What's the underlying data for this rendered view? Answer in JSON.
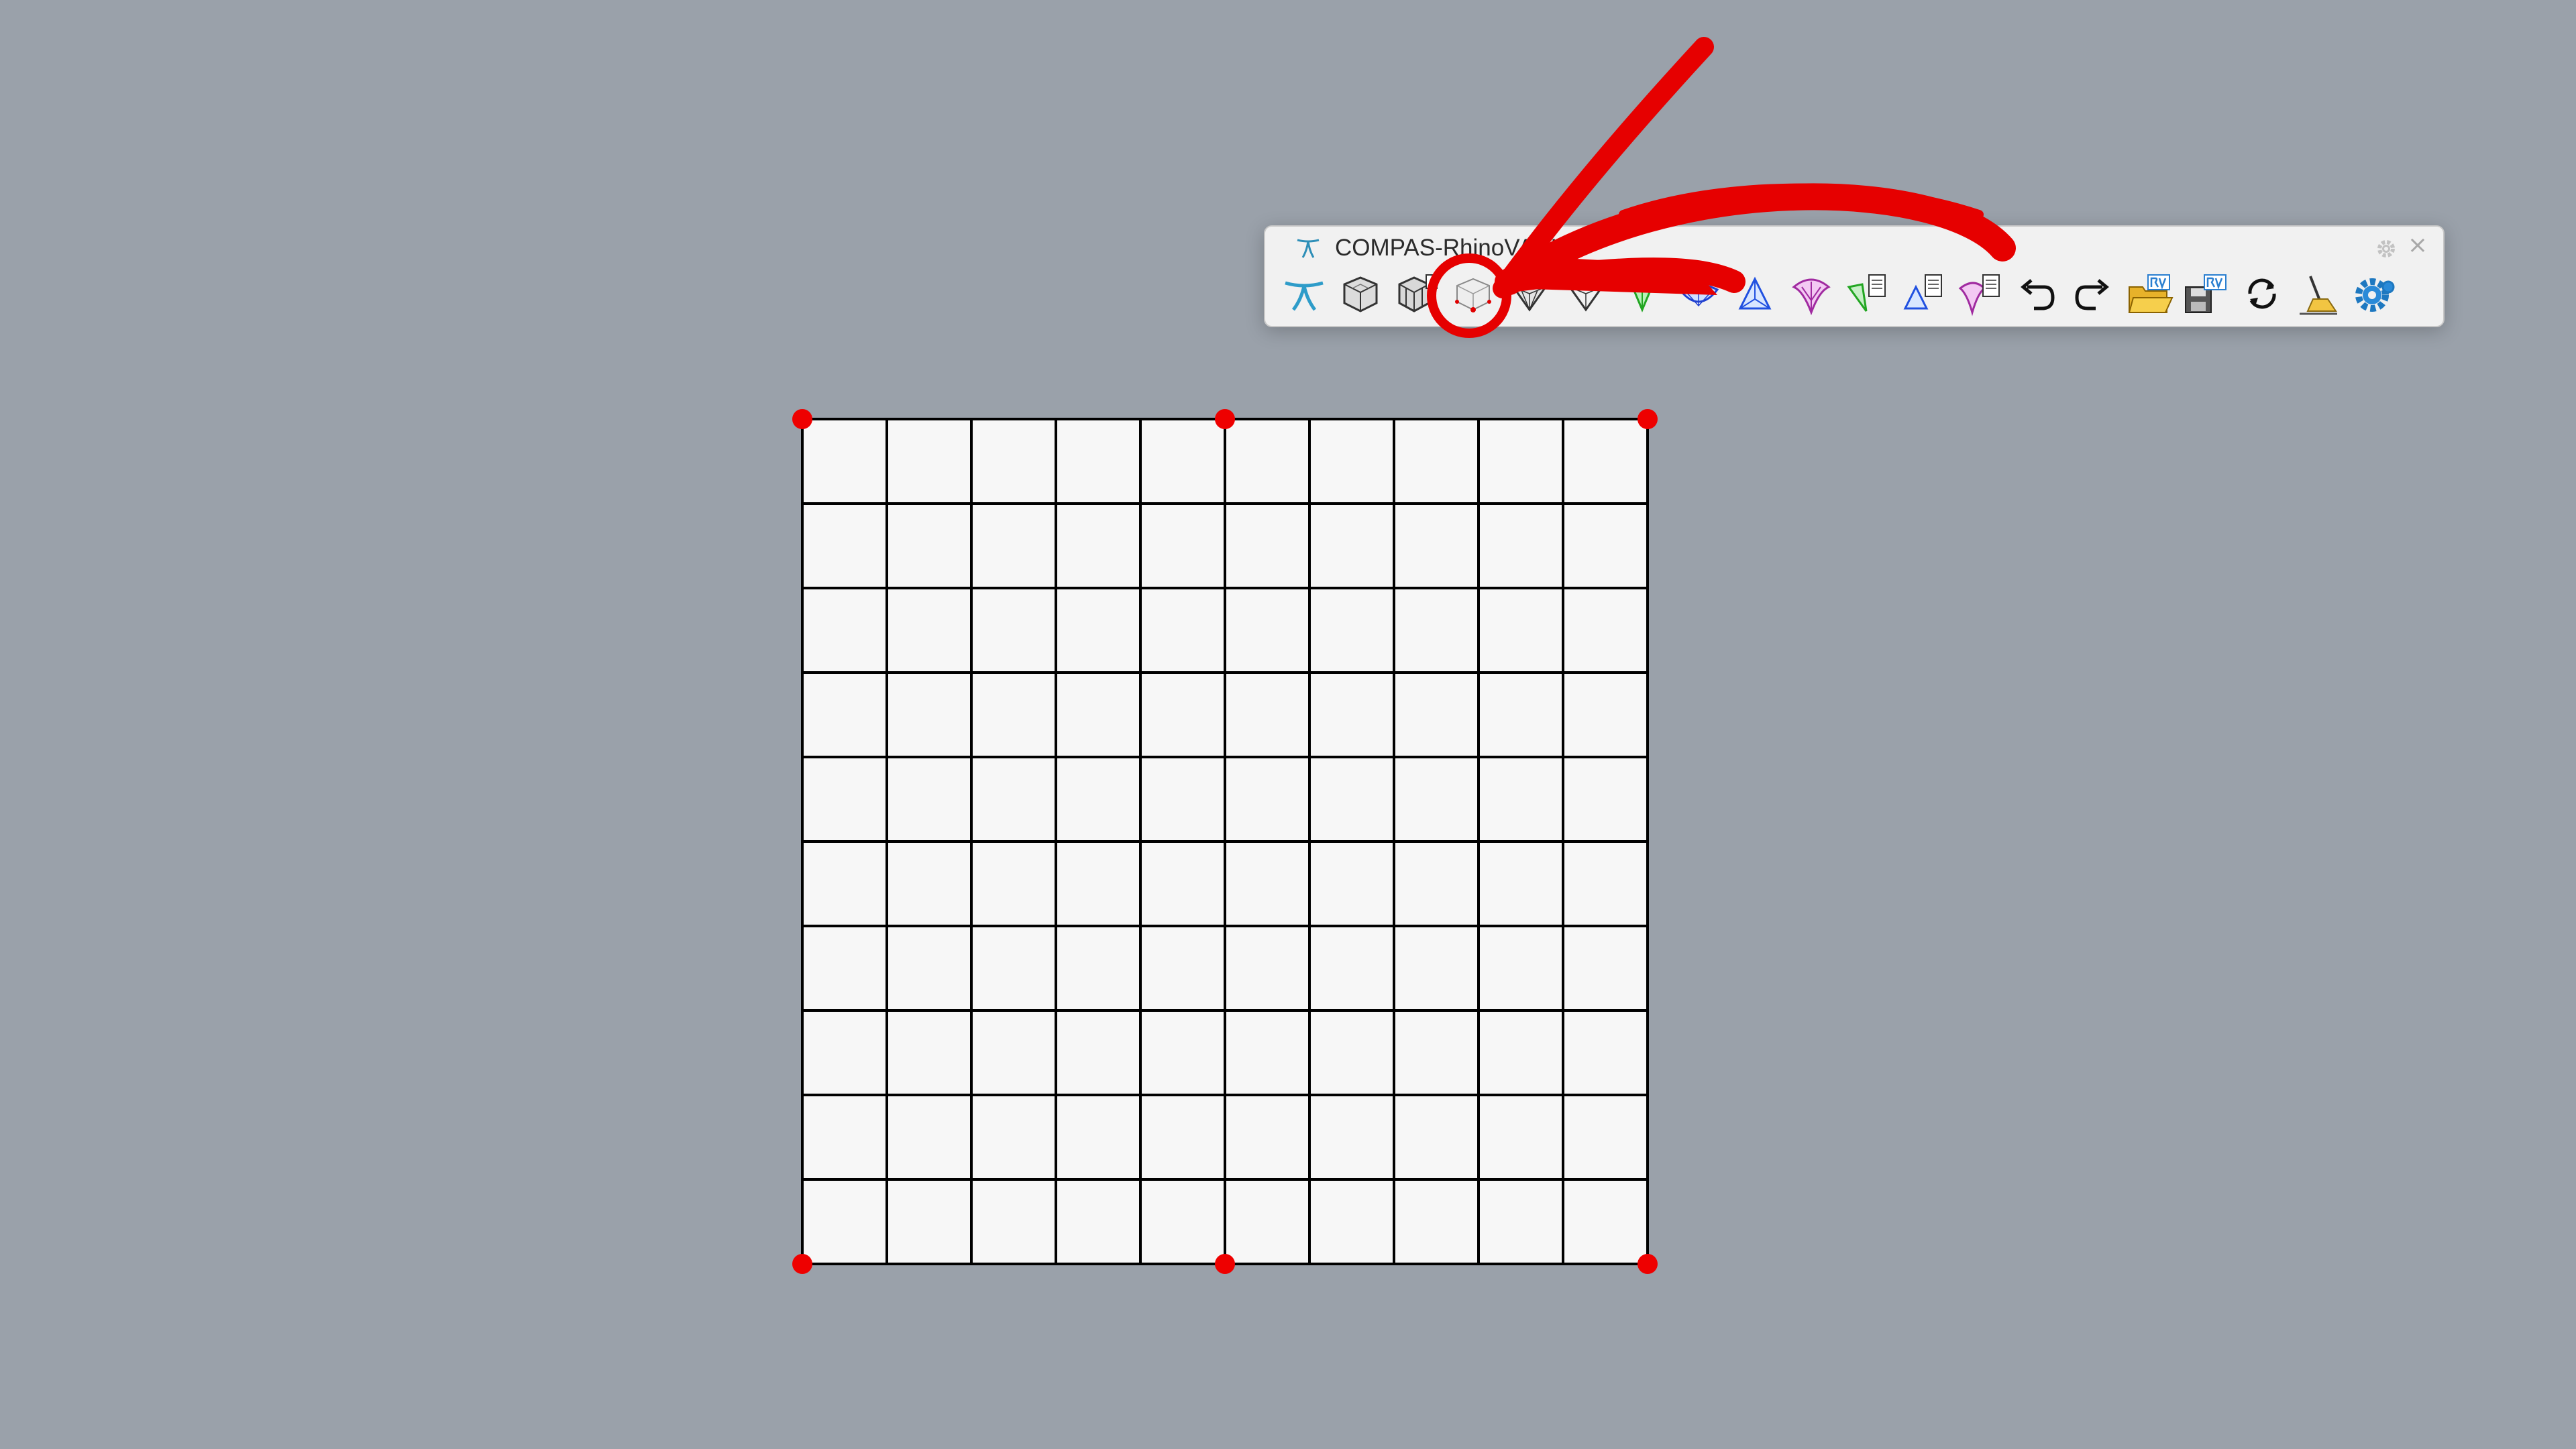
{
  "toolbar": {
    "title": "COMPAS-RhinoVAULT",
    "close_glyph": "×",
    "buttons": [
      {
        "name": "rv-logo-button",
        "icon": "rv-logo-icon"
      },
      {
        "name": "form-from-surface-button",
        "icon": "box-mesh-icon"
      },
      {
        "name": "form-from-mesh-button",
        "icon": "box-mesh-tagged-icon"
      },
      {
        "name": "identify-supports-button",
        "icon": "support-vertices-icon",
        "highlighted": true
      },
      {
        "name": "modify-form-button",
        "icon": "form-diagram-icon"
      },
      {
        "name": "modify-form-vertices-button",
        "icon": "form-vertices-icon"
      },
      {
        "name": "force-diagram-button",
        "icon": "force-diagram-green-icon"
      },
      {
        "name": "dual-button",
        "icon": "dual-blue-icon"
      },
      {
        "name": "horizontal-equilibrium-button",
        "icon": "horizontal-blue-icon"
      },
      {
        "name": "vertical-equilibrium-button",
        "icon": "vertical-magenta-icon"
      },
      {
        "name": "form-report-button",
        "icon": "form-report-green-icon"
      },
      {
        "name": "force-report-button",
        "icon": "force-report-blue-icon"
      },
      {
        "name": "thrust-report-button",
        "icon": "thrust-report-magenta-icon"
      },
      {
        "name": "undo-button",
        "icon": "undo-icon"
      },
      {
        "name": "redo-button",
        "icon": "redo-icon"
      },
      {
        "name": "open-file-button",
        "icon": "open-rv-folder-icon"
      },
      {
        "name": "save-file-button",
        "icon": "save-rv-disk-icon"
      },
      {
        "name": "refresh-button",
        "icon": "refresh-icon"
      },
      {
        "name": "clear-button",
        "icon": "broom-icon"
      },
      {
        "name": "settings-button",
        "icon": "gear-blue-icon"
      }
    ]
  },
  "mesh": {
    "rows": 10,
    "cols": 10,
    "support_color": "#ee0000",
    "line_color": "#000000",
    "fill_color": "#f7f7f7"
  },
  "annotation": {
    "color": "#e60000"
  }
}
